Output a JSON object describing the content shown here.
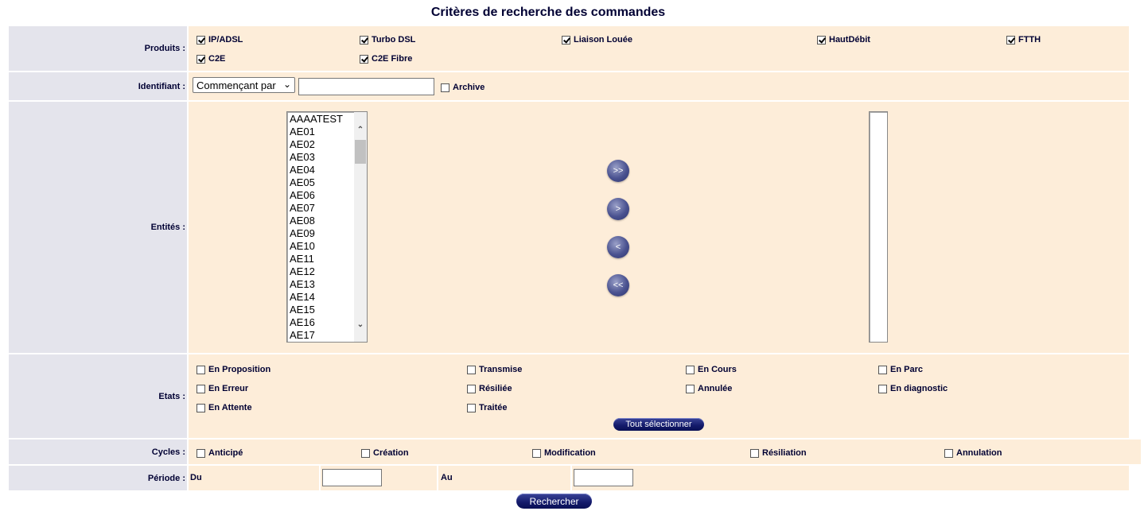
{
  "title": "Critères de recherche des commandes",
  "produits": {
    "label": "Produits :",
    "items": [
      {
        "label": "IP/ADSL",
        "checked": true
      },
      {
        "label": "Turbo DSL",
        "checked": true
      },
      {
        "label": "Liaison Louée",
        "checked": true
      },
      {
        "label": "HautDébit",
        "checked": true
      },
      {
        "label": "FTTH",
        "checked": true
      },
      {
        "label": "C2E",
        "checked": true
      },
      {
        "label": "C2E Fibre",
        "checked": true
      }
    ]
  },
  "identifiant": {
    "label": "Identifiant :",
    "mode": "Commençant par",
    "value": "",
    "archive_label": "Archive",
    "archive_checked": false
  },
  "entites": {
    "label": "Entités :",
    "available": [
      "AAAATEST",
      "AE01",
      "AE02",
      "AE03",
      "AE04",
      "AE05",
      "AE06",
      "AE07",
      "AE08",
      "AE09",
      "AE10",
      "AE11",
      "AE12",
      "AE13",
      "AE14",
      "AE15",
      "AE16",
      "AE17"
    ],
    "selected": [],
    "buttons": {
      "add_all": ">>",
      "add": ">",
      "remove": "<",
      "remove_all": "<<"
    }
  },
  "etats": {
    "label": "Etats :",
    "items": [
      {
        "label": "En Proposition",
        "checked": false
      },
      {
        "label": "Transmise",
        "checked": false
      },
      {
        "label": "En Cours",
        "checked": false
      },
      {
        "label": "En Parc",
        "checked": false
      },
      {
        "label": "En Erreur",
        "checked": false
      },
      {
        "label": "Résiliée",
        "checked": false
      },
      {
        "label": "Annulée",
        "checked": false
      },
      {
        "label": "En diagnostic",
        "checked": false
      },
      {
        "label": "En Attente",
        "checked": false
      },
      {
        "label": "Traitée",
        "checked": false
      }
    ],
    "select_all_label": "Tout sélectionner"
  },
  "cycles": {
    "label": "Cycles :",
    "items": [
      {
        "label": "Anticipé",
        "checked": false
      },
      {
        "label": "Création",
        "checked": false
      },
      {
        "label": "Modification",
        "checked": false
      },
      {
        "label": "Résiliation",
        "checked": false
      },
      {
        "label": "Annulation",
        "checked": false
      }
    ]
  },
  "periode": {
    "label": "Période :",
    "du_label": "Du",
    "du_value": "",
    "au_label": "Au",
    "au_value": ""
  },
  "search_button": "Rechercher"
}
